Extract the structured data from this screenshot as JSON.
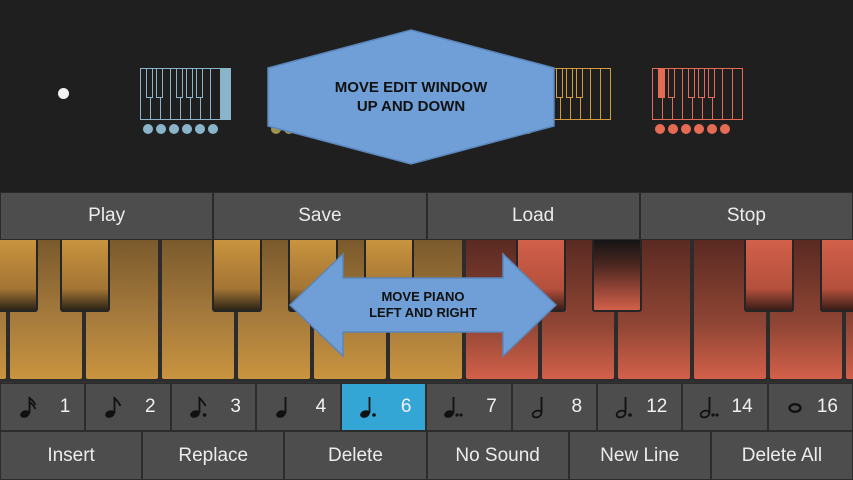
{
  "overview": {
    "edit_window_hint": "MOVE EDIT WINDOW UP AND DOWN",
    "edit_window_hint_lines": [
      "MOVE EDIT WINDOW",
      "UP AND DOWN"
    ],
    "sections": [
      {
        "color": "#8ab4c9",
        "dots": 6,
        "highlight": "last-white"
      },
      {
        "color": "#9e9450",
        "dots": 3,
        "highlight": "none"
      },
      {
        "color": "#d49a3e",
        "dots": 1,
        "highlight": "white-3"
      },
      {
        "color": "#e56b55",
        "dots": 6,
        "highlight": "black-1"
      }
    ]
  },
  "controls": {
    "play": "Play",
    "save": "Save",
    "load": "Load",
    "stop": "Stop"
  },
  "piano": {
    "hint_lines": [
      "MOVE PIANO",
      "LEFT AND RIGHT"
    ],
    "hint": "MOVE PIANO LEFT AND RIGHT",
    "warm_color": "#c9943f",
    "red_color": "#d2604a"
  },
  "durations": [
    {
      "icon": "sixteenth-note-icon",
      "value": "1"
    },
    {
      "icon": "eighth-note-icon",
      "value": "2"
    },
    {
      "icon": "dotted-eighth-note-icon",
      "value": "3"
    },
    {
      "icon": "quarter-note-icon",
      "value": "4"
    },
    {
      "icon": "dotted-quarter-note-icon",
      "value": "6",
      "selected": true
    },
    {
      "icon": "double-dotted-quarter-note-icon",
      "value": "7"
    },
    {
      "icon": "half-note-icon",
      "value": "8"
    },
    {
      "icon": "dotted-half-note-icon",
      "value": "12"
    },
    {
      "icon": "double-dotted-half-note-icon",
      "value": "14"
    },
    {
      "icon": "whole-note-icon",
      "value": "16"
    }
  ],
  "actions": {
    "insert": "Insert",
    "replace": "Replace",
    "delete": "Delete",
    "no_sound": "No Sound",
    "new_line": "New Line",
    "delete_all": "Delete All"
  },
  "colors": {
    "selected_duration": "#33a6d6",
    "button_bg": "#4d4d4d",
    "hint_arrow": "#6f9fd6"
  }
}
